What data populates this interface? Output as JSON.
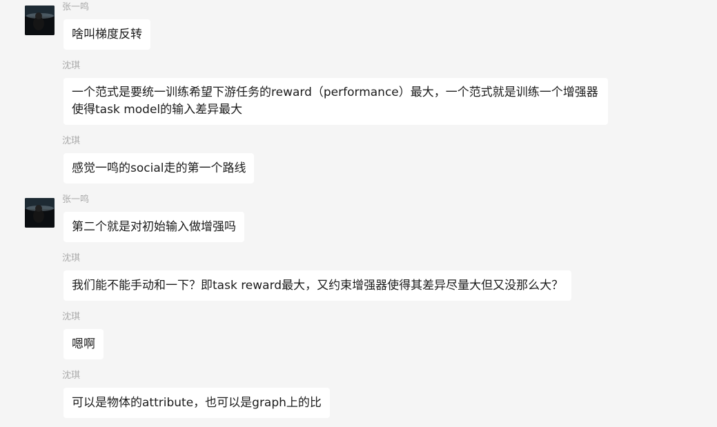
{
  "messages": [
    {
      "sender": "张一鸣",
      "text": "啥叫梯度反转",
      "avatar": true
    },
    {
      "sender": "沈琪",
      "text": "一个范式是要统一训练希望下游任务的reward（performance）最大，一个范式就是训练一个增强器使得task model的输入差异最大",
      "avatar": false
    },
    {
      "sender": "沈琪",
      "text": "感觉一鸣的social走的第一个路线",
      "avatar": false
    },
    {
      "sender": "张一鸣",
      "text": "第二个就是对初始输入做增强吗",
      "avatar": true
    },
    {
      "sender": "沈琪",
      "text": "我们能不能手动和一下？即task reward最大，又约束增强器使得其差异尽量大但又没那么大？",
      "avatar": false
    },
    {
      "sender": "沈琪",
      "text": "嗯啊",
      "avatar": false
    },
    {
      "sender": "沈琪",
      "text": "可以是物体的attribute，也可以是graph上的比",
      "avatar": false
    }
  ]
}
